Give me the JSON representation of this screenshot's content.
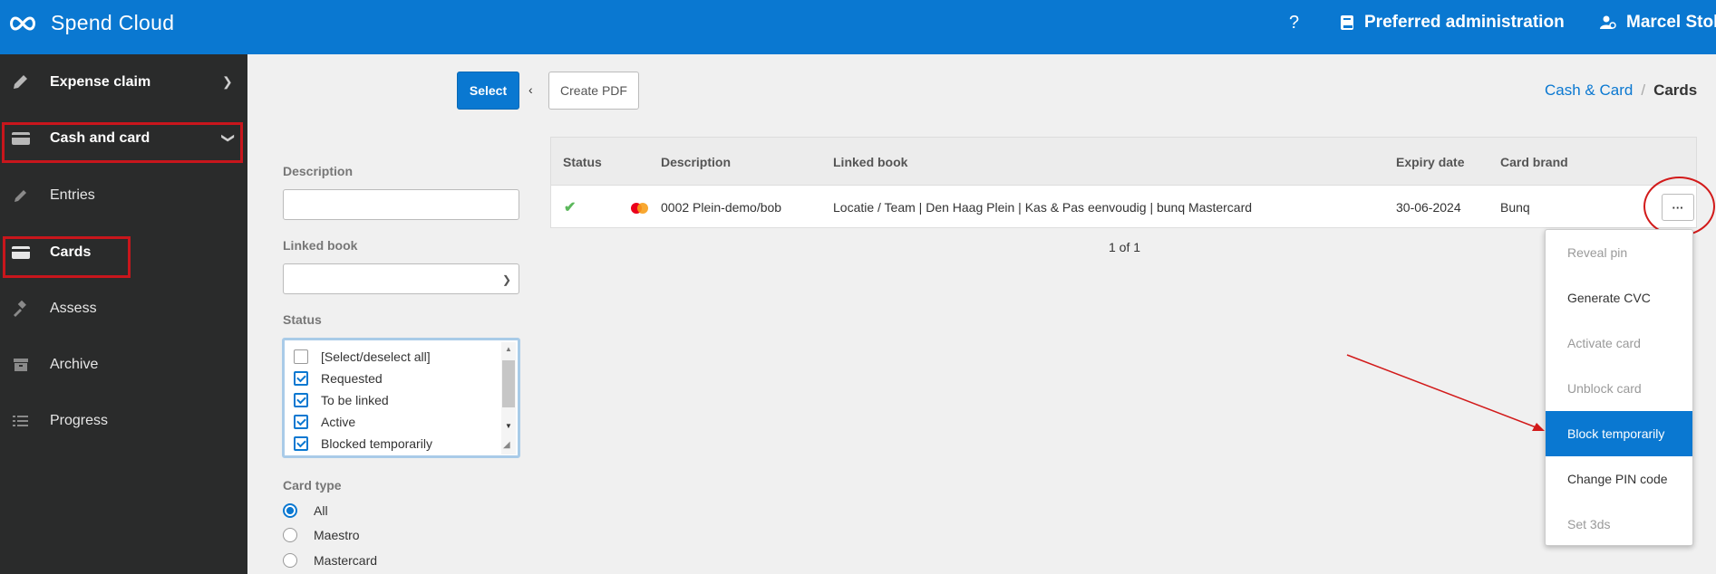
{
  "app": {
    "title": "Spend Cloud"
  },
  "header": {
    "help": "?",
    "administration": "Preferred administration",
    "user": "Marcel Stok"
  },
  "sidebar": {
    "items": [
      {
        "label": "Expense claim",
        "icon": "pencil-icon"
      },
      {
        "label": "Cash and card",
        "icon": "card-icon"
      },
      {
        "label": "Entries",
        "icon": "pencil-icon"
      },
      {
        "label": "Cards",
        "icon": "card-icon"
      },
      {
        "label": "Assess",
        "icon": "gavel-icon"
      },
      {
        "label": "Archive",
        "icon": "archive-icon"
      },
      {
        "label": "Progress",
        "icon": "list-icon"
      }
    ]
  },
  "toolbar": {
    "select_label": "Select",
    "back_label": "‹",
    "pdf_label": "Create PDF"
  },
  "breadcrumb": {
    "parent": "Cash & Card",
    "separator": "/",
    "current": "Cards"
  },
  "filters": {
    "description_label": "Description",
    "description_value": "",
    "linked_book_label": "Linked book",
    "linked_book_value": "",
    "status_label": "Status",
    "status_options": [
      {
        "label": "[Select/deselect all]",
        "checked": false
      },
      {
        "label": "Requested",
        "checked": true
      },
      {
        "label": "To be linked",
        "checked": true
      },
      {
        "label": "Active",
        "checked": true
      },
      {
        "label": "Blocked temporarily",
        "checked": true
      }
    ],
    "card_type_label": "Card type",
    "card_type_options": [
      {
        "label": "All",
        "selected": true
      },
      {
        "label": "Maestro",
        "selected": false
      },
      {
        "label": "Mastercard",
        "selected": false
      }
    ]
  },
  "table": {
    "headers": {
      "status": "Status",
      "description": "Description",
      "linked_book": "Linked book",
      "expiry": "Expiry date",
      "brand": "Card brand"
    },
    "rows": [
      {
        "status": "active",
        "description": "0002 Plein-demo/bob",
        "linked_book": "Locatie / Team | Den Haag Plein | Kas & Pas eenvoudig | bunq Mastercard",
        "expiry": "30-06-2024",
        "brand": "Bunq"
      }
    ],
    "more_label": "···",
    "pagination": "1 of 1"
  },
  "menu": {
    "items": [
      {
        "label": "Reveal pin",
        "disabled": true
      },
      {
        "label": "Generate CVC",
        "disabled": false
      },
      {
        "label": "Activate card",
        "disabled": true
      },
      {
        "label": "Unblock card",
        "disabled": true
      },
      {
        "label": "Block temporarily",
        "disabled": false,
        "highlighted": true
      },
      {
        "label": "Change PIN code",
        "disabled": false
      },
      {
        "label": "Set 3ds",
        "disabled": true
      }
    ]
  },
  "colors": {
    "brand": "#0a78d1",
    "sidebar": "#2a2b2b",
    "annotation": "#d21a1a",
    "success": "#5cb85c"
  }
}
